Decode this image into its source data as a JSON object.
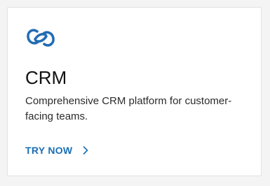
{
  "card": {
    "title": "CRM",
    "description": "Comprehensive CRM platform for customer-facing teams.",
    "cta_label": "TRY NOW",
    "logo_icon": "interlocking-rings-icon",
    "cta_icon": "chevron-right-icon"
  },
  "colors": {
    "accent": "#1a6fb5",
    "logo": "#226db4",
    "background": "#f4f4f5",
    "card": "#ffffff",
    "border": "#e2e2e6"
  }
}
